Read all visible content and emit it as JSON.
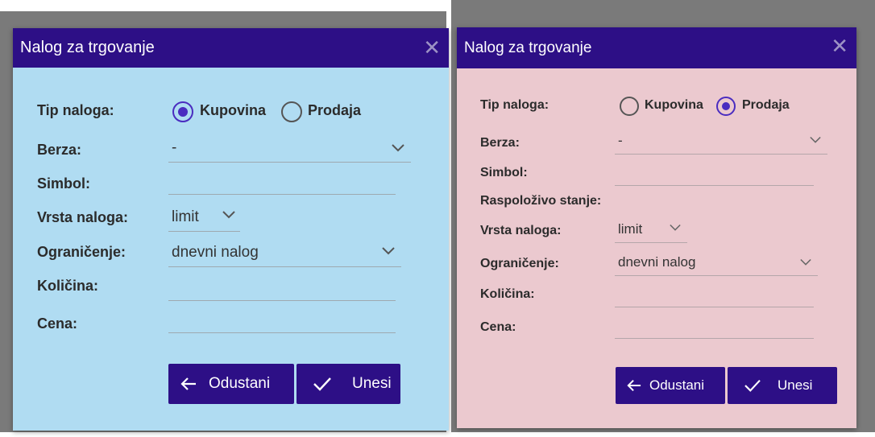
{
  "buy_dialog": {
    "title": "Nalog za trgovanje",
    "close_icon": "close-icon",
    "order_type": {
      "label": "Tip naloga:",
      "options": [
        "Kupovina",
        "Prodaja"
      ],
      "selected": "Kupovina"
    },
    "exchange": {
      "label": "Berza:",
      "value": "-"
    },
    "symbol": {
      "label": "Simbol:",
      "value": ""
    },
    "order_kind": {
      "label": "Vrsta naloga:",
      "value": "limit"
    },
    "restriction": {
      "label": "Ograničenje:",
      "value": "dnevni nalog"
    },
    "quantity": {
      "label": "Količina:",
      "value": ""
    },
    "price": {
      "label": "Cena:",
      "value": ""
    },
    "cancel_button": {
      "label": "Odustani",
      "icon": "arrow-left-icon"
    },
    "submit_button": {
      "label": "Unesi",
      "icon": "checkmark-icon"
    },
    "background_color": "#b0dcf2"
  },
  "sell_dialog": {
    "title": "Nalog za trgovanje",
    "close_icon": "close-icon",
    "order_type": {
      "label": "Tip naloga:",
      "options": [
        "Kupovina",
        "Prodaja"
      ],
      "selected": "Prodaja"
    },
    "exchange": {
      "label": "Berza:",
      "value": "-"
    },
    "symbol": {
      "label": "Simbol:",
      "value": ""
    },
    "available_balance": {
      "label": "Raspoloživo stanje:"
    },
    "order_kind": {
      "label": "Vrsta naloga:",
      "value": "limit"
    },
    "restriction": {
      "label": "Ograničenje:",
      "value": "dnevni nalog"
    },
    "quantity": {
      "label": "Količina:",
      "value": ""
    },
    "price": {
      "label": "Cena:",
      "value": ""
    },
    "cancel_button": {
      "label": "Odustani",
      "icon": "arrow-left-icon"
    },
    "submit_button": {
      "label": "Unesi",
      "icon": "checkmark-icon"
    },
    "background_color": "#ebc9cf"
  },
  "colors": {
    "title_bar": "#2d0f86",
    "button": "#2d0f86",
    "radio_selected": "#4a2cc0",
    "backdrop": "#7a7a7a"
  }
}
